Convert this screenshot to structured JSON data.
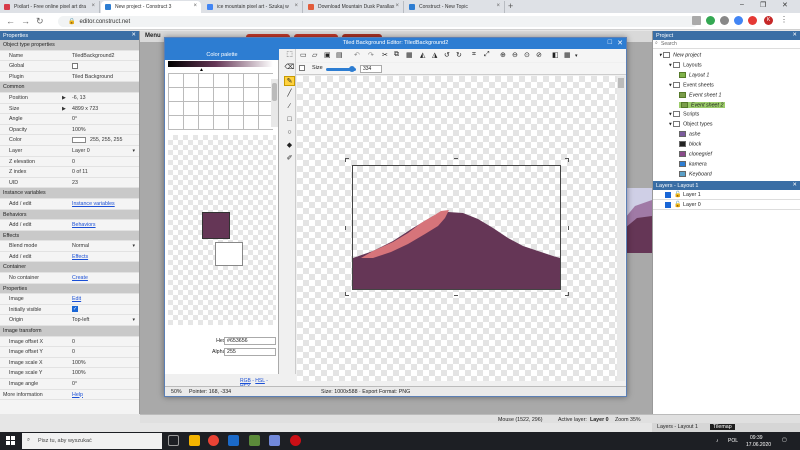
{
  "browser": {
    "tabs": [
      {
        "title": "Pixilart - Free online pixel art dra",
        "favicon_color": "#d73a49"
      },
      {
        "title": "New project - Construct 3",
        "favicon_color": "#2d7dd2",
        "active": true
      },
      {
        "title": "ice mountain pixel art - Szukaj w",
        "favicon_color": "#4285f4"
      },
      {
        "title": "Download Mountain Dusk Parallax",
        "favicon_color": "#e25c3b"
      },
      {
        "title": "Construct - New Topic",
        "favicon_color": "#2d7dd2"
      }
    ],
    "url": "editor.construct.net",
    "avatar_letter": "K"
  },
  "menu": {
    "label": "Menu"
  },
  "properties": {
    "title": "Properties",
    "rows": [
      {
        "type": "section",
        "label": "Object type properties"
      },
      {
        "key": "Name",
        "value": "TiledBackground2"
      },
      {
        "key": "Global",
        "value": "",
        "kind": "checkbox"
      },
      {
        "key": "Plugin",
        "value": "Tiled Background"
      },
      {
        "type": "section",
        "label": "Common"
      },
      {
        "key": "Position",
        "value": "-6, 13",
        "arrow": true
      },
      {
        "key": "Size",
        "value": "4899 x 723",
        "arrow": true
      },
      {
        "key": "Angle",
        "value": "0°"
      },
      {
        "key": "Opacity",
        "value": "100%"
      },
      {
        "key": "Color",
        "value": "255, 255, 255",
        "kind": "color"
      },
      {
        "key": "Layer",
        "value": "Layer 0",
        "kind": "dropdown"
      },
      {
        "key": "Z elevation",
        "value": "0"
      },
      {
        "key": "Z index",
        "value": "0 of 11"
      },
      {
        "key": "UID",
        "value": "23"
      },
      {
        "type": "section",
        "label": "Instance variables"
      },
      {
        "key": "Add / edit",
        "value": "Instance variables",
        "kind": "link"
      },
      {
        "type": "section",
        "label": "Behaviors"
      },
      {
        "key": "Add / edit",
        "value": "Behaviors",
        "kind": "link"
      },
      {
        "type": "section",
        "label": "Effects"
      },
      {
        "key": "Blend mode",
        "value": "Normal",
        "kind": "dropdown"
      },
      {
        "key": "Add / edit",
        "value": "Effects",
        "kind": "link"
      },
      {
        "type": "section",
        "label": "Container"
      },
      {
        "key": "No container",
        "value": "Create",
        "kind": "link"
      },
      {
        "type": "section",
        "label": "Properties"
      },
      {
        "key": "Image",
        "value": "Edit",
        "kind": "link"
      },
      {
        "key": "Initially visible",
        "value": "",
        "kind": "checkbox-on"
      },
      {
        "key": "Origin",
        "value": "Top-left",
        "kind": "dropdown"
      },
      {
        "type": "section",
        "label": "Image transform"
      },
      {
        "key": "Image offset X",
        "value": "0"
      },
      {
        "key": "Image offset Y",
        "value": "0"
      },
      {
        "key": "Image scale X",
        "value": "100%"
      },
      {
        "key": "Image scale Y",
        "value": "100%"
      },
      {
        "key": "Image angle",
        "value": "0°"
      },
      {
        "key": "More information",
        "value": "Help",
        "kind": "link",
        "nopad": true
      }
    ]
  },
  "editor": {
    "title": "Tiled Background Editor: TiledBackground2",
    "palette": {
      "title": "Color palette",
      "primary_color": "#653656",
      "secondary_color": "#ffffff",
      "hex_label": "Hex:",
      "hex_value": "#653656",
      "alpha_label": "Alpha:",
      "alpha_value": "255",
      "modes": [
        "RGB",
        "HSL",
        "HEX"
      ]
    },
    "size_label": "Size",
    "size_value": "334",
    "colors": {
      "mountain_dark": "#653656",
      "mountain_light": "#d6747a",
      "accent": "#2d7dd2",
      "selected_tool": "#ffd23f"
    },
    "status": {
      "zoom": "50%",
      "pointer": "Pointer: 168, -334",
      "size_info": "Size: 1000x588 · Export Format: PNG"
    }
  },
  "project": {
    "title": "Project",
    "search_placeholder": "Search",
    "tree": [
      {
        "label": "New project",
        "indent": 0,
        "italic": true,
        "icon": "folder"
      },
      {
        "label": "Layouts",
        "indent": 1,
        "icon": "folder"
      },
      {
        "label": "Layout 1",
        "indent": 2,
        "italic": true,
        "icon": "layout"
      },
      {
        "label": "Event sheets",
        "indent": 1,
        "icon": "folder"
      },
      {
        "label": "Event sheet 1",
        "indent": 2,
        "italic": true,
        "icon": "sheet"
      },
      {
        "label": "Event sheet 2",
        "indent": 2,
        "italic": true,
        "icon": "sheet",
        "selected": true
      },
      {
        "label": "Scripts",
        "indent": 1,
        "icon": "folder"
      },
      {
        "label": "Object types",
        "indent": 1,
        "icon": "folder"
      },
      {
        "label": "ashe",
        "indent": 2,
        "italic": true,
        "icon": "sprite-ashe"
      },
      {
        "label": "block",
        "indent": 2,
        "italic": true,
        "icon": "sprite-block"
      },
      {
        "label": "clonegrief",
        "indent": 2,
        "italic": true,
        "icon": "sprite-clone"
      },
      {
        "label": "kamera",
        "indent": 2,
        "italic": true,
        "icon": "sprite-kamera"
      },
      {
        "label": "Keyboard",
        "indent": 2,
        "italic": true,
        "icon": "sprite-keyboard"
      }
    ]
  },
  "layers": {
    "title": "Layers - Layout 1",
    "items": [
      {
        "label": "Layer 1"
      },
      {
        "label": "Layer 0"
      }
    ]
  },
  "app_status": {
    "mouse": "Mouse (1522, 296)",
    "active_layer_label": "Active layer:",
    "active_layer": "Layer 0",
    "zoom": "Zoom 35%"
  },
  "bottom_tabs": [
    "Layers - Layout 1",
    "Tilemap"
  ],
  "taskbar": {
    "search_placeholder": "Pisz tu, aby wyszukać",
    "lang": "POL",
    "time": "09:39",
    "date": "17.06.2020"
  }
}
